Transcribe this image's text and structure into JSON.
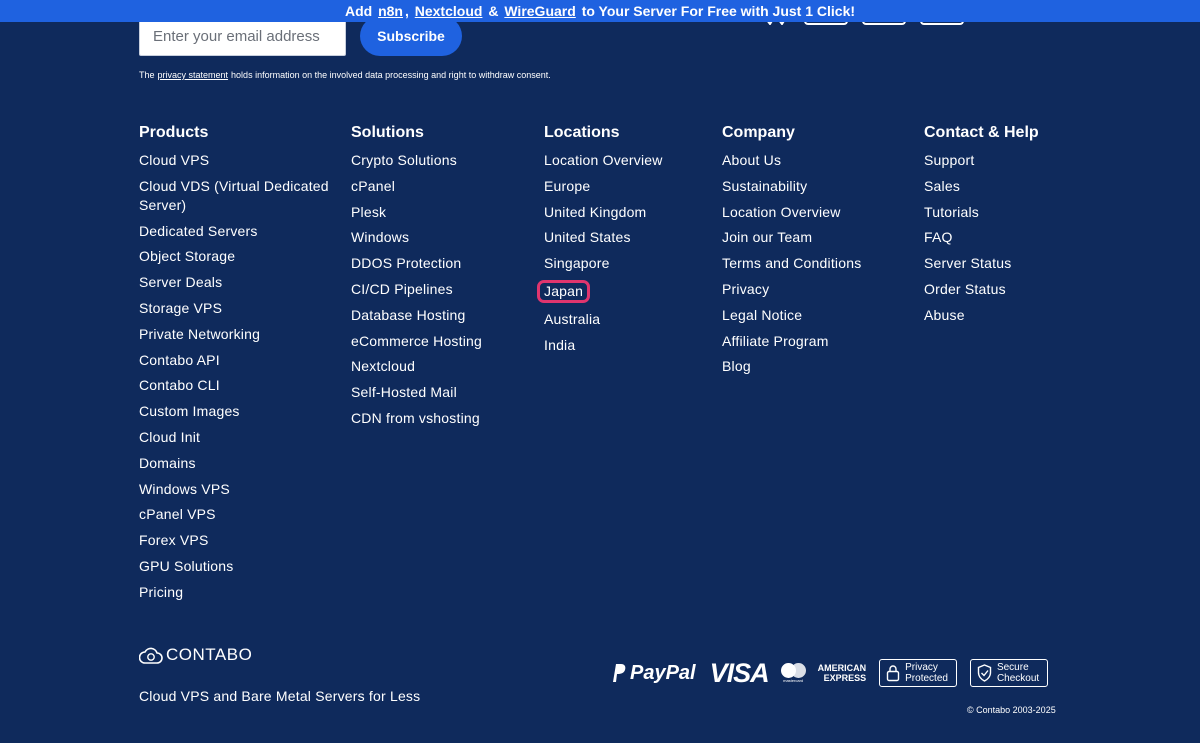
{
  "promo": {
    "prefix": "Add",
    "link1": "n8n",
    "sep1": ",",
    "link2": "Nextcloud",
    "sep2": "&",
    "link3": "WireGuard",
    "suffix": "to Your Server For Free with Just 1 Click!"
  },
  "newsletter": {
    "email_placeholder": "Enter your email address",
    "subscribe_label": "Subscribe",
    "consent_prefix": "The",
    "consent_link": "privacy statement",
    "consent_suffix": "holds information on the involved data processing and right to withdraw consent."
  },
  "footer": {
    "products": {
      "heading": "Products",
      "items": [
        "Cloud VPS",
        "Cloud VDS (Virtual Dedicated Server)",
        "Dedicated Servers",
        "Object Storage",
        "Server Deals",
        "Storage VPS",
        "Private Networking",
        "Contabo API",
        "Contabo CLI",
        "Custom Images",
        "Cloud Init",
        "Domains",
        "Windows VPS",
        "cPanel VPS",
        "Forex VPS",
        "GPU Solutions",
        "Pricing"
      ]
    },
    "solutions": {
      "heading": "Solutions",
      "items": [
        "Crypto Solutions",
        "cPanel",
        "Plesk",
        "Windows",
        "DDOS Protection",
        "CI/CD Pipelines",
        "Database Hosting",
        "eCommerce Hosting",
        "Nextcloud",
        "Self-Hosted Mail",
        "CDN from vshosting"
      ]
    },
    "locations": {
      "heading": "Locations",
      "items": [
        "Location Overview",
        "Europe",
        "United Kingdom",
        "United States",
        "Singapore",
        "Japan",
        "Australia",
        "India"
      ],
      "highlighted": "Japan"
    },
    "company": {
      "heading": "Company",
      "items": [
        "About Us",
        "Sustainability",
        "Location Overview",
        "Join our Team",
        "Terms and Conditions",
        "Privacy",
        "Legal Notice",
        "Affiliate Program",
        "Blog"
      ]
    },
    "contact": {
      "heading": "Contact & Help",
      "items": [
        "Support",
        "Sales",
        "Tutorials",
        "FAQ",
        "Server Status",
        "Order Status",
        "Abuse"
      ]
    }
  },
  "brand": {
    "logo_text": "CONTABO",
    "tagline": "Cloud VPS and Bare Metal Servers for Less"
  },
  "payments": {
    "paypal": "PayPal",
    "visa": "VISA",
    "mastercard_text": "mastercard",
    "amex_line1": "AMERICAN",
    "amex_line2": "EXPRESS",
    "privacy_badge_line1": "Privacy",
    "privacy_badge_line2": "Protected",
    "secure_badge_line1": "Secure",
    "secure_badge_line2": "Checkout"
  },
  "copyright": "© Contabo 2003-2025",
  "colors": {
    "background": "#0f2a5c",
    "accent": "#1f62e0",
    "highlight": "#e0356e"
  }
}
